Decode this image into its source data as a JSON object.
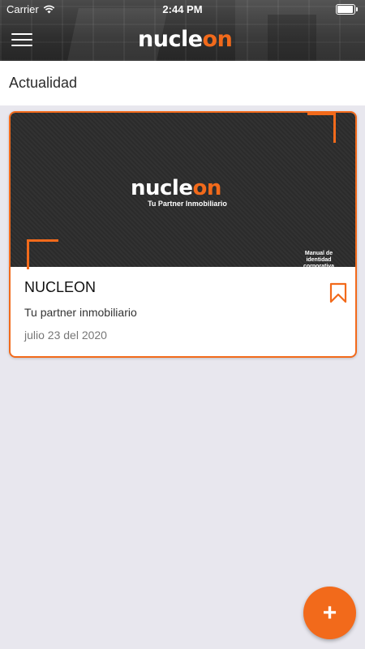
{
  "status_bar": {
    "carrier": "Carrier",
    "time": "2:44 PM",
    "wifi_icon": "wifi-icon",
    "battery_icon": "battery-icon"
  },
  "header": {
    "menu_icon": "hamburger-menu-icon",
    "logo": {
      "part1": "nucle",
      "part2": "on"
    }
  },
  "section": {
    "title": "Actualidad"
  },
  "cards": [
    {
      "banner": {
        "logo_part1": "nucle",
        "logo_part2": "on",
        "tagline": "Tu Partner Inmobiliario",
        "manual_text": "Manual de identidad corporativa"
      },
      "title": "NUCLEON",
      "subtitle": "Tu partner inmobiliario",
      "date": "julio 23 del 2020",
      "bookmark_icon": "bookmark-icon"
    }
  ],
  "fab": {
    "label": "+",
    "icon": "plus-icon"
  },
  "colors": {
    "accent": "#f26a1b",
    "background": "#e8e7ee",
    "header": "#2f2f2f"
  }
}
